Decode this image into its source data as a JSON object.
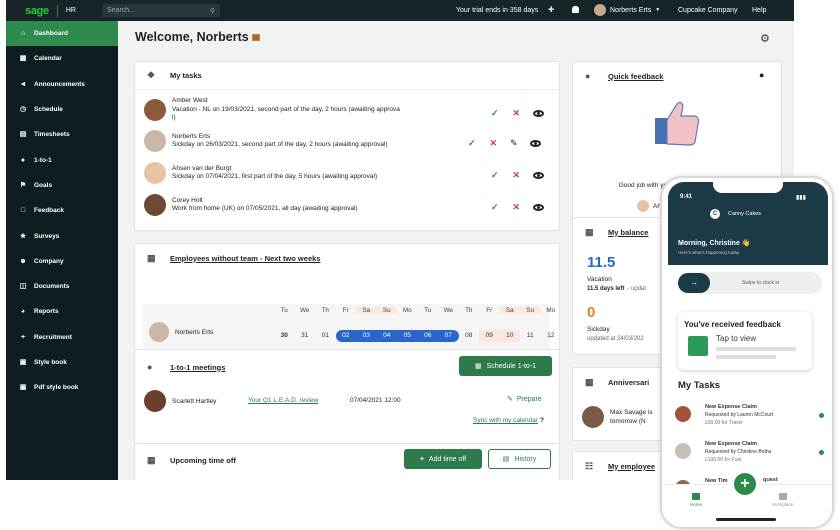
{
  "topbar": {
    "logo": "sage",
    "module": "HR",
    "search_placeholder": "Search...",
    "trial": "Your trial ends in 358 days",
    "user": "Norberts Erts",
    "company": "Cupcake Company",
    "help": "Help"
  },
  "sidebar": {
    "items": [
      {
        "label": "Dashboard",
        "icon": "home-icon"
      },
      {
        "label": "Calendar",
        "icon": "calendar-icon"
      },
      {
        "label": "Announcements",
        "icon": "megaphone-icon"
      },
      {
        "label": "Schedule",
        "icon": "clock-icon"
      },
      {
        "label": "Timesheets",
        "icon": "timesheet-icon"
      },
      {
        "label": "1-to-1",
        "icon": "chat-icon"
      },
      {
        "label": "Goals",
        "icon": "flag-icon"
      },
      {
        "label": "Feedback",
        "icon": "feedback-icon"
      },
      {
        "label": "Surveys",
        "icon": "star-icon"
      },
      {
        "label": "Company",
        "icon": "people-icon"
      },
      {
        "label": "Documents",
        "icon": "folder-icon"
      },
      {
        "label": "Reports",
        "icon": "chart-icon"
      },
      {
        "label": "Recruitment",
        "icon": "add-user-icon"
      },
      {
        "label": "Style book",
        "icon": "book-icon"
      },
      {
        "label": "Pdf style book",
        "icon": "pdf-icon"
      }
    ]
  },
  "main": {
    "welcome": "Welcome, Norberts"
  },
  "tasks": {
    "title": "My tasks",
    "items": [
      {
        "name": "Amber West",
        "desc": "Vacation - NL on 19/03/2021, second part of the day, 2 hours (awaiting approva",
        "desc2": "l)"
      },
      {
        "name": "Norberts Erts",
        "desc": "Sickday on 26/03/2021, second part of the day, 2 hours (awaiting approval)",
        "desc2": ""
      },
      {
        "name": "Ahsen van der Burgt",
        "desc": "Sickday on 07/04/2021, first part of the day, 5 hours (awaiting approval)",
        "desc2": ""
      },
      {
        "name": "Corey Holt",
        "desc": "Work from home (UK) on 07/05/2021, all day (awaiting approval)",
        "desc2": ""
      }
    ]
  },
  "team": {
    "title": "Employees without team - Next two weeks",
    "days": [
      "Tu",
      "We",
      "Th",
      "Fr",
      "Sa",
      "Su",
      "Mo",
      "Tu",
      "We",
      "Th",
      "Fr",
      "Sa",
      "Su",
      "Mo"
    ],
    "dates": [
      "30",
      "31",
      "01",
      "02",
      "03",
      "04",
      "05",
      "06",
      "07",
      "08",
      "09",
      "10",
      "11",
      "12"
    ],
    "employee": "Norberts Erts"
  },
  "meetings": {
    "title": "1-to-1 meetings",
    "button": "Schedule 1-to-1",
    "person": "Scarlett Hartley",
    "meeting": "Your Q1 L.E.A.D. review",
    "date": "07/04/2021 12:00",
    "prepare": "Prepare",
    "sync": "Sync with my calendar"
  },
  "timeoff": {
    "title": "Upcoming time off",
    "add": "Add time off",
    "history": "History"
  },
  "quickfeedback": {
    "title": "Quick feedback",
    "text": "Good job with your objectives this month!",
    "person": "Ah"
  },
  "balance": {
    "title": "My balance",
    "vacation_value": "11.5",
    "vacation_label": "Vacation",
    "vacation_left": "11.5 days left",
    "vacation_suffix": "- updat",
    "sick_value": "0",
    "sick_label": "Sickday",
    "sick_updated": "updated at 24/03/202"
  },
  "anniversaries": {
    "title": "Anniversari",
    "person": "Max Savage is",
    "when": "tomorrow (N"
  },
  "employees": {
    "title": "My employee"
  },
  "phone": {
    "time": "9:41",
    "app": "Canny Cakes",
    "greeting": "Morning, Christine",
    "greeting_emoji": "👋",
    "sub": "Here's what's happening today",
    "swipe": "Swipe to clock in",
    "feedback_title": "You've received feedback",
    "tap": "Tap to view",
    "tasks_title": "My Tasks",
    "tasks": [
      {
        "title": "New Expense Claim",
        "by": "Requested by Lauren McCourt",
        "amount": "£30.00 for Travel"
      },
      {
        "title": "New Expense Claim",
        "by": "Requested by Christine Botha",
        "amount": "£100.00 for Fuel"
      },
      {
        "title": "New Tim",
        "by": "",
        "amount": "",
        "suffix": "quest"
      }
    ],
    "nav_home": "Home",
    "nav_other": "Workplace"
  },
  "colors": {
    "sidebar": "#0f1d22",
    "active": "#2f8a4d",
    "primary_green": "#2d7a4a",
    "selected_blue": "#2a66c9"
  }
}
